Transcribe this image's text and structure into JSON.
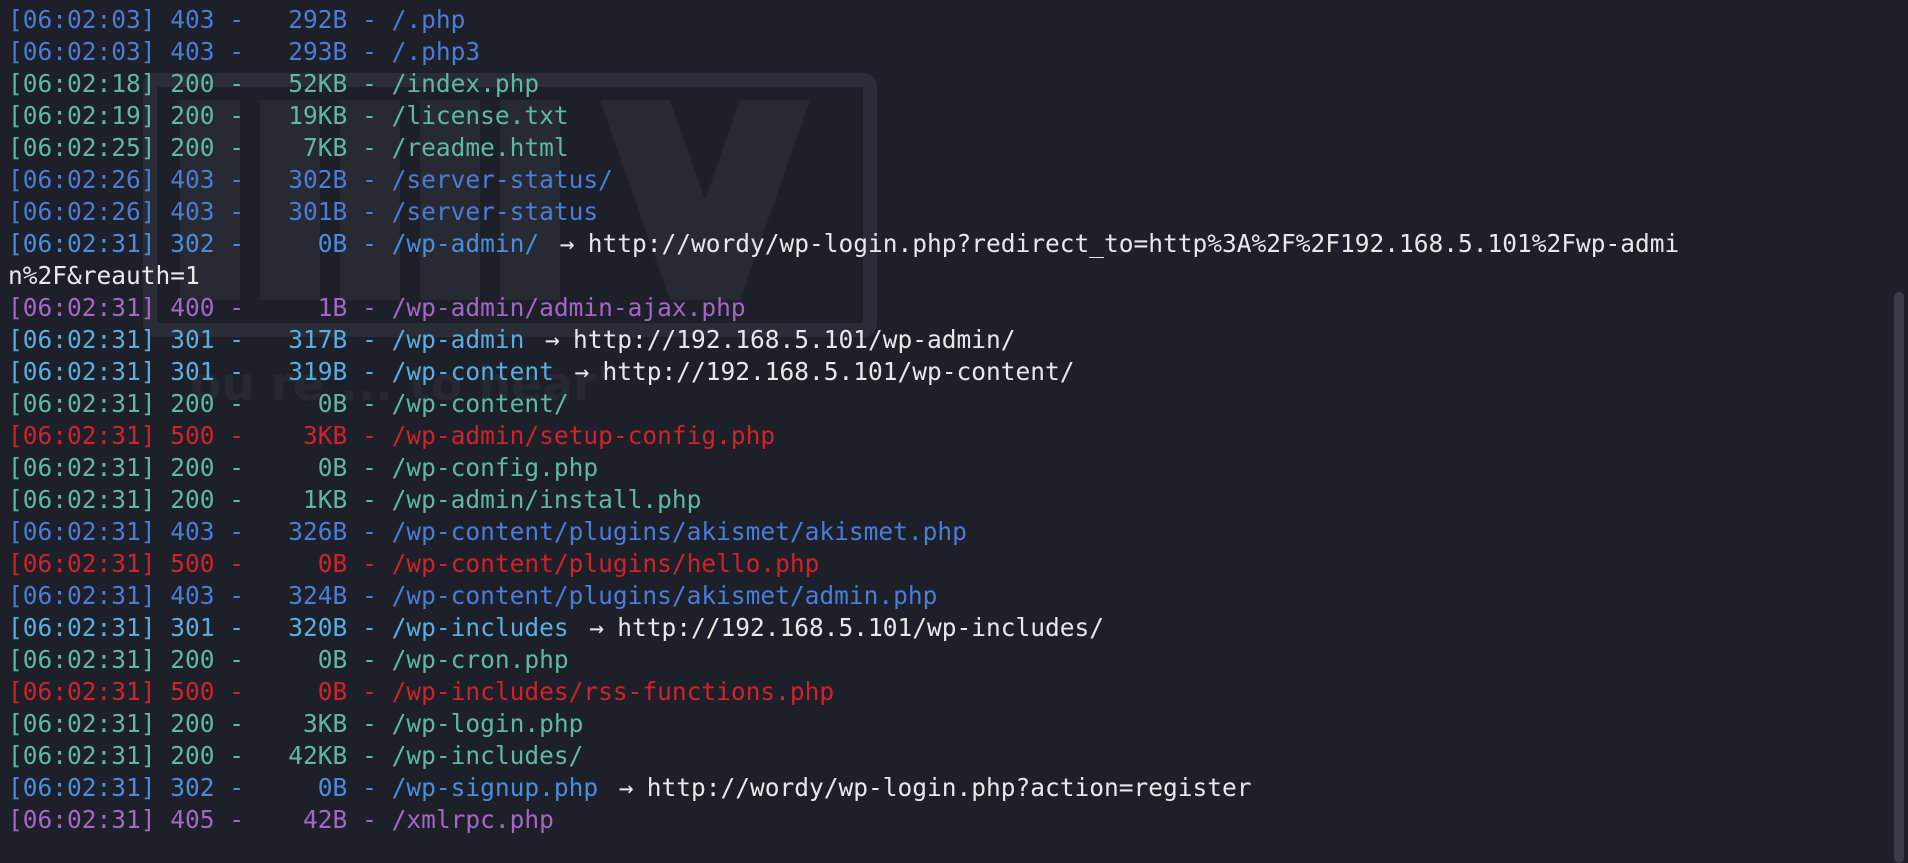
{
  "lines": [
    {
      "ts": "[06:02:03]",
      "status": "403",
      "size": "292B",
      "path": "/.php",
      "redirect": ""
    },
    {
      "ts": "[06:02:03]",
      "status": "403",
      "size": "293B",
      "path": "/.php3",
      "redirect": ""
    },
    {
      "ts": "[06:02:18]",
      "status": "200",
      "size": "52KB",
      "path": "/index.php",
      "redirect": ""
    },
    {
      "ts": "[06:02:19]",
      "status": "200",
      "size": "19KB",
      "path": "/license.txt",
      "redirect": ""
    },
    {
      "ts": "[06:02:25]",
      "status": "200",
      "size": "7KB",
      "path": "/readme.html",
      "redirect": ""
    },
    {
      "ts": "[06:02:26]",
      "status": "403",
      "size": "302B",
      "path": "/server-status/",
      "redirect": ""
    },
    {
      "ts": "[06:02:26]",
      "status": "403",
      "size": "301B",
      "path": "/server-status",
      "redirect": ""
    },
    {
      "ts": "[06:02:31]",
      "status": "302",
      "size": "0B",
      "path": "/wp-admin/",
      "redirect": "http://wordy/wp-login.php?redirect_to=http%3A%2F%2F192.168.5.101%2Fwp-admi"
    },
    {
      "wrap": "n%2F&reauth=1"
    },
    {
      "ts": "[06:02:31]",
      "status": "400",
      "size": "1B",
      "path": "/wp-admin/admin-ajax.php",
      "redirect": ""
    },
    {
      "ts": "[06:02:31]",
      "status": "301",
      "size": "317B",
      "path": "/wp-admin",
      "redirect": "http://192.168.5.101/wp-admin/"
    },
    {
      "ts": "[06:02:31]",
      "status": "301",
      "size": "319B",
      "path": "/wp-content",
      "redirect": "http://192.168.5.101/wp-content/"
    },
    {
      "ts": "[06:02:31]",
      "status": "200",
      "size": "0B",
      "path": "/wp-content/",
      "redirect": ""
    },
    {
      "ts": "[06:02:31]",
      "status": "500",
      "size": "3KB",
      "path": "/wp-admin/setup-config.php",
      "redirect": ""
    },
    {
      "ts": "[06:02:31]",
      "status": "200",
      "size": "0B",
      "path": "/wp-config.php",
      "redirect": ""
    },
    {
      "ts": "[06:02:31]",
      "status": "200",
      "size": "1KB",
      "path": "/wp-admin/install.php",
      "redirect": ""
    },
    {
      "ts": "[06:02:31]",
      "status": "403",
      "size": "326B",
      "path": "/wp-content/plugins/akismet/akismet.php",
      "redirect": ""
    },
    {
      "ts": "[06:02:31]",
      "status": "500",
      "size": "0B",
      "path": "/wp-content/plugins/hello.php",
      "redirect": ""
    },
    {
      "ts": "[06:02:31]",
      "status": "403",
      "size": "324B",
      "path": "/wp-content/plugins/akismet/admin.php",
      "redirect": ""
    },
    {
      "ts": "[06:02:31]",
      "status": "301",
      "size": "320B",
      "path": "/wp-includes",
      "redirect": "http://192.168.5.101/wp-includes/"
    },
    {
      "ts": "[06:02:31]",
      "status": "200",
      "size": "0B",
      "path": "/wp-cron.php",
      "redirect": ""
    },
    {
      "ts": "[06:02:31]",
      "status": "500",
      "size": "0B",
      "path": "/wp-includes/rss-functions.php",
      "redirect": ""
    },
    {
      "ts": "[06:02:31]",
      "status": "200",
      "size": "3KB",
      "path": "/wp-login.php",
      "redirect": ""
    },
    {
      "ts": "[06:02:31]",
      "status": "200",
      "size": "42KB",
      "path": "/wp-includes/",
      "redirect": ""
    },
    {
      "ts": "[06:02:31]",
      "status": "302",
      "size": "0B",
      "path": "/wp-signup.php",
      "redirect": "http://wordy/wp-login.php?action=register"
    },
    {
      "ts": "[06:02:31]",
      "status": "405",
      "size": "42B",
      "path": "/xmlrpc.php",
      "redirect": ""
    }
  ],
  "arrow_glyph": "→",
  "colors": {
    "background": "#1e2029",
    "status_200": "#5fb9a0",
    "status_301": "#58aee0",
    "status_302": "#4a8de0",
    "status_403": "#4a7cd8",
    "status_400": "#a466c7",
    "status_405": "#a466c7",
    "status_500": "#d0222a",
    "redirect_text": "#e8e8ea"
  },
  "watermark_icon": "kali-linux-watermark-icon"
}
